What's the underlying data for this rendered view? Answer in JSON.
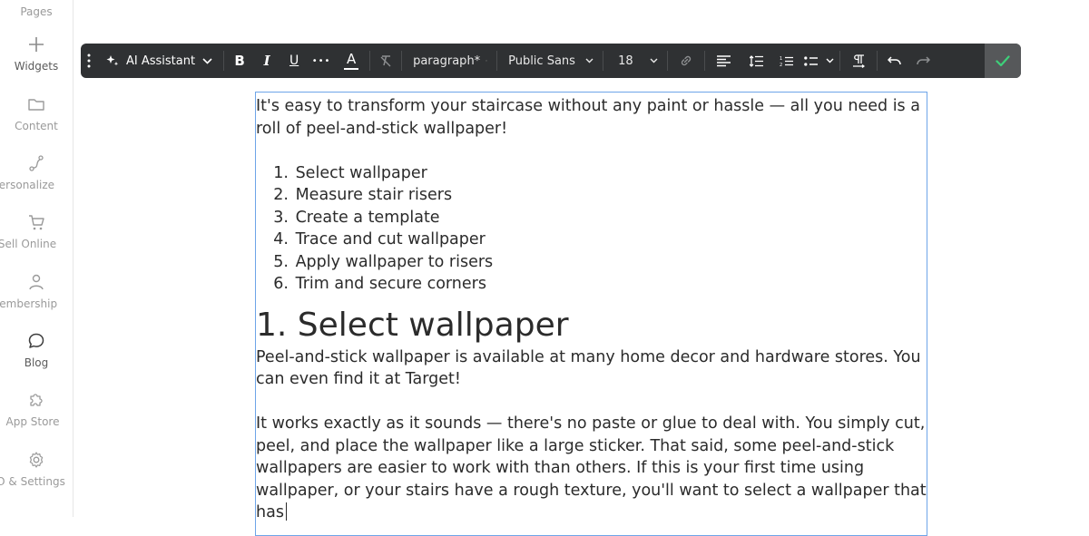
{
  "sidebar": {
    "items": [
      {
        "label": "Pages",
        "icon": "pages-icon"
      },
      {
        "label": "Widgets",
        "icon": "plus-icon"
      },
      {
        "label": "Content",
        "icon": "folder-icon"
      },
      {
        "label": "Personalize",
        "icon": "route-icon"
      },
      {
        "label": "Sell Online",
        "icon": "cart-icon"
      },
      {
        "label": "Membership",
        "icon": "person-icon"
      },
      {
        "label": "Blog",
        "icon": "chat-bubble-icon"
      },
      {
        "label": "App Store",
        "icon": "puzzle-icon"
      },
      {
        "label": "O & Settings",
        "icon": "gear-icon"
      }
    ]
  },
  "toolbar": {
    "ai_label": "AI Assistant",
    "bold": "B",
    "italic": "I",
    "underline": "U",
    "more": "•••",
    "text_color": "A",
    "style_value": "paragraph*",
    "font_value": "Public Sans",
    "size_value": "18"
  },
  "editor": {
    "intro": "It's easy to transform your staircase without any paint or hassle — all you need is a roll of peel-and-stick wallpaper!",
    "steps": [
      {
        "num": "1.",
        "text": "Select wallpaper"
      },
      {
        "num": "2.",
        "text": "Measure stair risers"
      },
      {
        "num": "3.",
        "text": "Create a template"
      },
      {
        "num": "4.",
        "text": "Trace and cut wallpaper"
      },
      {
        "num": "5.",
        "text": "Apply wallpaper to risers"
      },
      {
        "num": "6.",
        "text": "Trim and secure corners"
      }
    ],
    "heading": "1. Select wallpaper",
    "para1": "Peel-and-stick wallpaper is available at many home decor and hardware stores. You can even find it at Target!",
    "para2": "It works exactly as it sounds — there's no paste or glue to deal with. You simply cut, peel, and place the wallpaper like a large sticker. That said, some peel-and-stick wallpapers are easier to work with than others. If this is your first time using wallpaper, or your stairs have a rough texture, you'll want to select a wallpaper that has"
  },
  "colors": {
    "toolbar_bg": "#2f3133",
    "editor_border": "#6ea5e8",
    "confirm_check": "#3ecf7a"
  }
}
